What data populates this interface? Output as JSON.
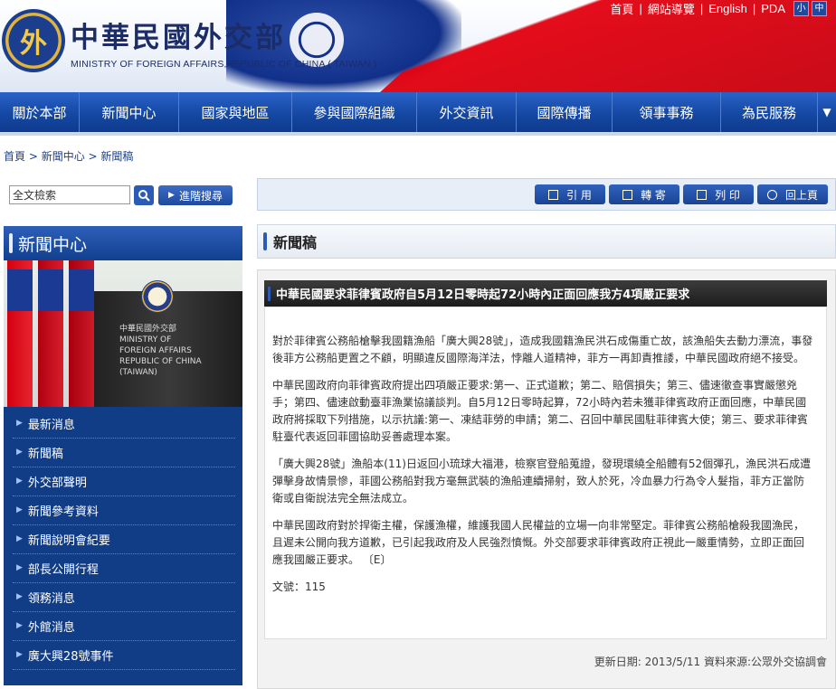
{
  "header": {
    "emblem_char": "外",
    "title_cn": "中華民國外交部",
    "title_en": "MINISTRY OF FOREIGN AFFAIRS,REPUBLIC OF CHINA ( TAIWAN )",
    "links": [
      "首頁",
      "網站導覽",
      "English",
      "PDA"
    ],
    "font_small": "小",
    "font_mid": "中"
  },
  "nav": {
    "items": [
      "關於本部",
      "新聞中心",
      "國家與地區",
      "參與國際組織",
      "外交資訊",
      "國際傳播",
      "領事事務",
      "為民服務"
    ],
    "more_icon": "chevron-down-icon"
  },
  "breadcrumb": {
    "home": "首頁",
    "sep": " > ",
    "section": "新聞中心",
    "current": "新聞稿"
  },
  "search": {
    "placeholder": "全文檢索",
    "value": "全文檢索",
    "advanced_label": "進階搜尋"
  },
  "left": {
    "heading": "新聞中心",
    "photo_text": "中華民國外交部 MINISTRY OF FOREIGN AFFAIRS REPUBLIC OF CHINA (TAIWAN)",
    "menu": [
      "最新消息",
      "新聞稿",
      "外交部聲明",
      "新聞參考資料",
      "新聞說明會紀要",
      "部長公開行程",
      "領務消息",
      "外館消息",
      "廣大興28號事件"
    ]
  },
  "toolbar": {
    "cite": "引 用",
    "mail": "轉 寄",
    "print": "列 印",
    "back": "回上頁"
  },
  "section": {
    "title": "新聞稿"
  },
  "article": {
    "title": "中華民國要求菲律賓政府自5月12日零時起72小時內正面回應我方4項嚴正要求",
    "paragraphs": [
      "對於菲律賓公務船槍擊我國籍漁船「廣大興28號」，造成我國籍漁民洪石成傷重亡故，該漁船失去動力漂流，事發後菲方公務船更置之不顧，明顯違反國際海洋法，悖離人道精神，菲方一再卸責推諉，中華民國政府絕不接受。",
      "中華民國政府向菲律賓政府提出四項嚴正要求:第一、正式道歉；第二、賠償損失；第三、儘速徹查事實嚴懲兇手；第四、儘速啟動臺菲漁業協議談判。自5月12日零時起算，72小時內若未獲菲律賓政府正面回應，中華民國政府將採取下列措施，以示抗議:第一、凍結菲勞的申請；第二、召回中華民國駐菲律賓大使；第三、要求菲律賓駐臺代表返回菲國協助妥善處理本案。",
      "「廣大興28號」漁船本(11)日返回小琉球大福港，檢察官登船蒐證，發現環繞全船體有52個彈孔，漁民洪石成遭彈擊身故情景慘，菲國公務船對我方毫無武裝的漁船連續掃射，致人於死，冷血暴力行為令人髮指，菲方正當防衛或自衛說法完全無法成立。",
      "中華民國政府對於捍衛主權，保護漁權，維護我國人民權益的立場一向非常堅定。菲律賓公務船槍殺我國漁民，且遲未公開向我方道歉，已引起我政府及人民強烈憤慨。外交部要求菲律賓政府正視此一嚴重情勢，立即正面回應我國嚴正要求。 〔E〕",
      "文號：115"
    ]
  },
  "footer": {
    "update": "更新日期: 2013/5/11 資料來源:公眾外交協調會"
  },
  "colors": {
    "nav_blue": "#164aa6",
    "left_menu": "#113c86",
    "title_bar": "#2a2a2a"
  }
}
